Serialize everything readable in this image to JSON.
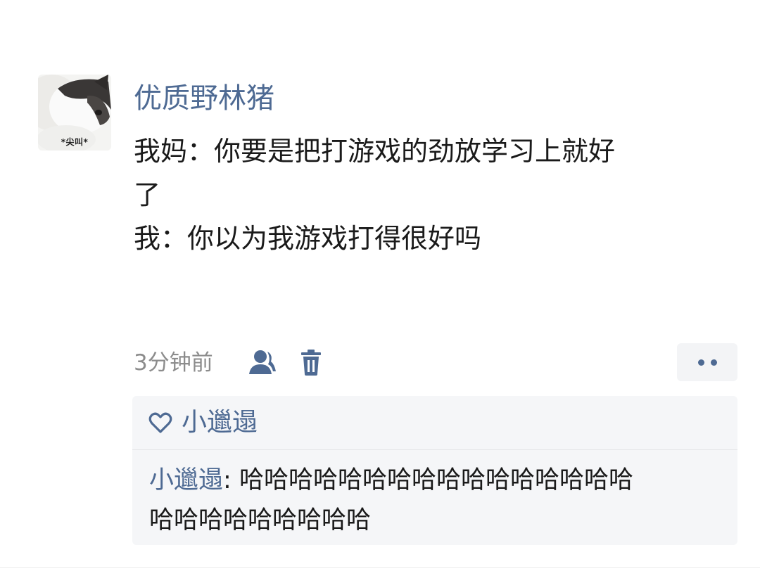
{
  "post": {
    "avatar": {
      "icon": "cat-avatar-icon",
      "caption": "*尖叫*"
    },
    "username": "优质野林猪",
    "body_lines": [
      "我妈：你要是把打游戏的劲放学习上就好",
      "了",
      "我：你以为我游戏打得很好吗"
    ],
    "time": "3分钟前",
    "meta_icons": [
      "user-icon",
      "trash-icon",
      "more-icon"
    ]
  },
  "likes": {
    "icon": "heart-icon",
    "names": "小邋遢"
  },
  "comment": {
    "author": "小邋遢",
    "separator": ": ",
    "text_line1": "哈哈哈哈哈哈哈哈哈哈哈哈哈哈哈哈",
    "text_line2": "哈哈哈哈哈哈哈哈哈"
  },
  "colors": {
    "link": "#4e6a93",
    "text": "#1a1a1a",
    "muted": "#8c8c8c",
    "panel": "#f5f6f8"
  }
}
